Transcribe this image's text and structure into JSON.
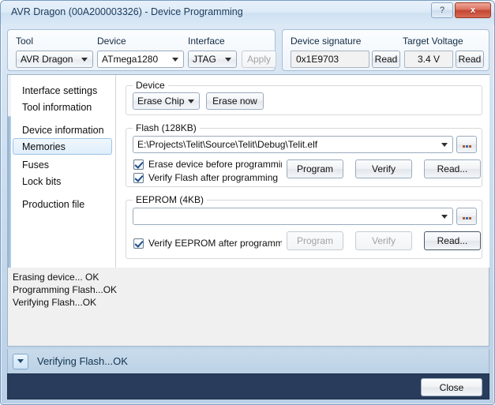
{
  "window": {
    "title": "AVR Dragon (00A200003326) - Device Programming",
    "help_label": "?",
    "close_label": "x"
  },
  "toolbar": {
    "tool_label": "Tool",
    "tool_value": "AVR Dragon",
    "device_label": "Device",
    "device_value": "ATmega1280",
    "interface_label": "Interface",
    "interface_value": "JTAG",
    "apply_label": "Apply",
    "signature_label": "Device signature",
    "signature_value": "0x1E9703",
    "signature_read_label": "Read",
    "voltage_label": "Target Voltage",
    "voltage_value": "3.4 V",
    "voltage_read_label": "Read"
  },
  "sidebar": {
    "items": [
      {
        "label": "Interface settings",
        "selected": false
      },
      {
        "label": "Tool information",
        "selected": false
      },
      {
        "label": "Device information",
        "selected": false
      },
      {
        "label": "Memories",
        "selected": true
      },
      {
        "label": "Fuses",
        "selected": false
      },
      {
        "label": "Lock bits",
        "selected": false
      },
      {
        "label": "Production file",
        "selected": false
      }
    ]
  },
  "device_group": {
    "legend": "Device",
    "erase_mode": "Erase Chip",
    "erase_now_label": "Erase now"
  },
  "flash_group": {
    "legend": "Flash (128KB)",
    "path_value": "E:\\Projects\\Telit\\Source\\Telit\\Debug\\Telit.elf",
    "browse_label": "...",
    "erase_before_label": "Erase device before programming",
    "verify_after_label": "Verify Flash after programming",
    "program_label": "Program",
    "verify_label": "Verify",
    "read_label": "Read..."
  },
  "eeprom_group": {
    "legend": "EEPROM (4KB)",
    "path_value": "",
    "browse_label": "...",
    "verify_after_label": "Verify EEPROM after programming",
    "program_label": "Program",
    "verify_label": "Verify",
    "read_label": "Read..."
  },
  "log": {
    "lines": "Erasing device... OK\nProgramming Flash...OK\nVerifying Flash...OK"
  },
  "statusbar": {
    "text": "Verifying Flash...OK"
  },
  "footer": {
    "close_label": "Close"
  },
  "colors": {
    "accent": "#1f4a74",
    "close_red": "#c34632",
    "selection_blue": "#9cc3e3",
    "footer_navy": "#293c5c"
  }
}
